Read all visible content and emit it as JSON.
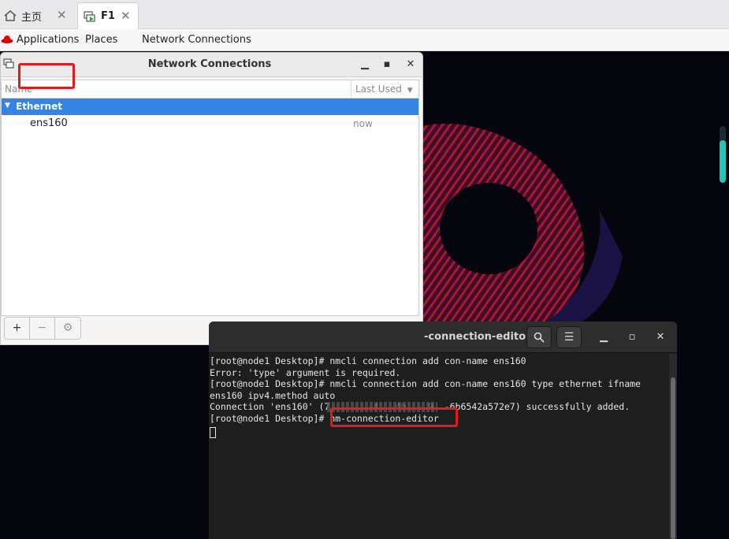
{
  "browser_tabs": [
    {
      "label": "主页",
      "icon": "home-icon",
      "active": false
    },
    {
      "label": "F1",
      "icon": "vm-console-icon",
      "active": true
    }
  ],
  "topbar": {
    "applications": "Applications",
    "places": "Places",
    "app_name": "Network Connections"
  },
  "network_connections": {
    "title": "Network Connections",
    "columns": {
      "name": "Name",
      "last_used": "Last Used"
    },
    "groups": [
      {
        "name": "Ethernet",
        "connections": [
          {
            "name": "ens160",
            "last_used": "now"
          }
        ]
      }
    ],
    "toolbar": {
      "add": "+",
      "remove": "−",
      "settings": "⚙"
    }
  },
  "terminal": {
    "title": "-connection-editor",
    "lines": [
      "[root@node1 Desktop]# nmcli connection add con-name ens160",
      "Error: 'type' argument is required.",
      "[root@node1 Desktop]# nmcli connection add con-name ens160 type ethernet ifname",
      "ens160 ipv4.method auto",
      "Connection 'ens160' (7       -4  -4b  - 9  -6b6542a572e7) successfully added.",
      "[root@node1 Desktop]# nm-connection-editor"
    ]
  },
  "colors": {
    "accent": "#3584e4",
    "highlight_box": "#e51b1b",
    "terminal_bg": "#1e1e1e"
  }
}
